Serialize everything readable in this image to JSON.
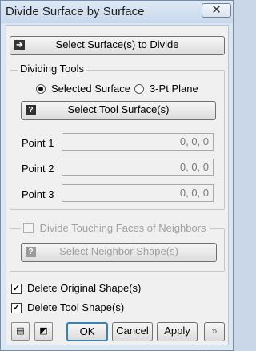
{
  "window": {
    "title": "Divide Surface by Surface",
    "close_glyph": "✕"
  },
  "select_surfaces_button": {
    "label": "Select Surface(s) to Divide",
    "icon": "arrow-into-box-icon"
  },
  "dividing_tools": {
    "caption": "Dividing Tools",
    "radio_options": [
      {
        "label": "Selected Surface",
        "checked": true
      },
      {
        "label": "3-Pt Plane",
        "checked": false
      }
    ],
    "select_tool_button": {
      "label": "Select Tool Surface(s)",
      "icon": "question-icon"
    },
    "points": [
      {
        "label": "Point 1",
        "value": "0, 0, 0"
      },
      {
        "label": "Point 2",
        "value": "0, 0, 0"
      },
      {
        "label": "Point 3",
        "value": "0, 0, 0"
      }
    ]
  },
  "neighbors": {
    "caption": "Divide Touching Faces of Neighbors",
    "checked": false,
    "select_neighbor_button": {
      "label": "Select Neighbor Shape(s)",
      "icon": "question-icon"
    }
  },
  "options": [
    {
      "label": "Delete Original Shape(s)",
      "checked": true
    },
    {
      "label": "Delete Tool Shape(s)",
      "checked": true
    }
  ],
  "footer": {
    "left_icons": [
      "dialog-settings-icon",
      "eraser-icon"
    ],
    "ok_label": "OK",
    "cancel_label": "Cancel",
    "apply_label": "Apply",
    "more_label": "»"
  }
}
